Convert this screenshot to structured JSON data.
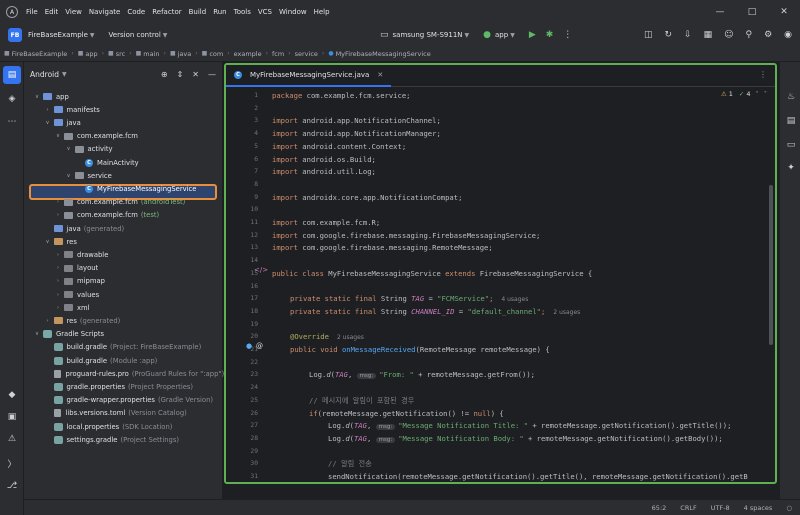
{
  "menu": {
    "logo": "A",
    "items": [
      "File",
      "Edit",
      "View",
      "Navigate",
      "Code",
      "Refactor",
      "Build",
      "Run",
      "Tools",
      "VCS",
      "Window",
      "Help"
    ]
  },
  "toolbar": {
    "project_badge": "FB",
    "project_name": "FireBaseExample",
    "vcs": "Version control",
    "device": "samsung SM-S911N",
    "run_config": "app"
  },
  "breadcrumb": [
    "FireBaseExample",
    "app",
    "src",
    "main",
    "java",
    "com",
    "example",
    "fcm",
    "service",
    "MyFirebaseMessagingService"
  ],
  "project_panel": {
    "title": "Android",
    "tree": [
      {
        "label": "app",
        "note": "",
        "depth": 0,
        "arrow": "down",
        "icon": "folder"
      },
      {
        "label": "manifests",
        "note": "",
        "depth": 1,
        "arrow": "right",
        "icon": "folder"
      },
      {
        "label": "java",
        "note": "",
        "depth": 1,
        "arrow": "down",
        "icon": "folder"
      },
      {
        "label": "com.example.fcm",
        "note": "",
        "depth": 2,
        "arrow": "down",
        "icon": "pkg"
      },
      {
        "label": "activity",
        "note": "",
        "depth": 3,
        "arrow": "down",
        "icon": "pkg"
      },
      {
        "label": "MainActivity",
        "note": "",
        "depth": 4,
        "arrow": "",
        "icon": "class"
      },
      {
        "label": "service",
        "note": "",
        "depth": 3,
        "arrow": "down",
        "icon": "pkg"
      },
      {
        "label": "MyFirebaseMessagingService",
        "note": "",
        "depth": 4,
        "arrow": "",
        "icon": "class"
      },
      {
        "label": "com.example.fcm",
        "note": "(androidTest)",
        "depth": 2,
        "arrow": "right",
        "icon": "pkg"
      },
      {
        "label": "com.example.fcm",
        "note": "(test)",
        "depth": 2,
        "arrow": "right",
        "icon": "pkg"
      },
      {
        "label": "java",
        "note": "(generated)",
        "depth": 1,
        "arrow": "",
        "icon": "folder"
      },
      {
        "label": "res",
        "note": "",
        "depth": 1,
        "arrow": "down",
        "icon": "res"
      },
      {
        "label": "drawable",
        "note": "",
        "depth": 2,
        "arrow": "right",
        "icon": "gray"
      },
      {
        "label": "layout",
        "note": "",
        "depth": 2,
        "arrow": "right",
        "icon": "gray"
      },
      {
        "label": "mipmap",
        "note": "",
        "depth": 2,
        "arrow": "right",
        "icon": "gray"
      },
      {
        "label": "values",
        "note": "",
        "depth": 2,
        "arrow": "right",
        "icon": "gray"
      },
      {
        "label": "xml",
        "note": "",
        "depth": 2,
        "arrow": "right",
        "icon": "gray"
      },
      {
        "label": "res",
        "note": "(generated)",
        "depth": 1,
        "arrow": "right",
        "icon": "res"
      },
      {
        "label": "Gradle Scripts",
        "note": "",
        "depth": 0,
        "arrow": "down",
        "icon": "scripts"
      },
      {
        "label": "build.gradle",
        "note": "(Project: FireBaseExample)",
        "depth": 1,
        "arrow": "",
        "icon": "gradle"
      },
      {
        "label": "build.gradle",
        "note": "(Module :app)",
        "depth": 1,
        "arrow": "",
        "icon": "gradle"
      },
      {
        "label": "proguard-rules.pro",
        "note": "(ProGuard Rules for \":app\")",
        "depth": 1,
        "arrow": "",
        "icon": "file"
      },
      {
        "label": "gradle.properties",
        "note": "(Project Properties)",
        "depth": 1,
        "arrow": "",
        "icon": "gradle"
      },
      {
        "label": "gradle-wrapper.properties",
        "note": "(Gradle Version)",
        "depth": 1,
        "arrow": "",
        "icon": "gradle"
      },
      {
        "label": "libs.versions.toml",
        "note": "(Version Catalog)",
        "depth": 1,
        "arrow": "",
        "icon": "file"
      },
      {
        "label": "local.properties",
        "note": "(SDK Location)",
        "depth": 1,
        "arrow": "",
        "icon": "gradle"
      },
      {
        "label": "settings.gradle",
        "note": "(Project Settings)",
        "depth": 1,
        "arrow": "",
        "icon": "gradle"
      }
    ]
  },
  "editor": {
    "tab": "MyFirebaseMessagingService.java",
    "warnings": "1",
    "ok_count": "4",
    "line_numbers": [
      "1",
      "2",
      "3",
      "4",
      "5",
      "6",
      "7",
      "8",
      "9",
      "10",
      "11",
      "12",
      "13",
      "14",
      "15",
      "16",
      "17",
      "18",
      "19",
      "20",
      "21",
      "22",
      "23",
      "24",
      "25",
      "26",
      "27",
      "28",
      "29",
      "30",
      "31"
    ],
    "code": {
      "l1": {
        "kw": "package ",
        "rest": "com.example.fcm.service;"
      },
      "l3": {
        "kw": "import ",
        "rest": "android.app.NotificationChannel;"
      },
      "l4": {
        "kw": "import ",
        "rest": "android.app.NotificationManager;"
      },
      "l5": {
        "kw": "import ",
        "rest": "android.content.Context;"
      },
      "l6": {
        "kw": "import ",
        "rest": "android.os.Build;"
      },
      "l7": {
        "kw": "import ",
        "rest": "android.util.Log;"
      },
      "l9": {
        "kw": "import ",
        "rest": "androidx.core.app.NotificationCompat;"
      },
      "l11": {
        "kw": "import ",
        "rest": "com.example.fcm.R;"
      },
      "l12": {
        "kw": "import ",
        "rest": "com.google.firebase.messaging.FirebaseMessagingService;"
      },
      "l13": {
        "kw": "import ",
        "rest": "com.google.firebase.messaging.RemoteMessage;"
      },
      "l15": {
        "kw1": "public class ",
        "name": "MyFirebaseMessagingService ",
        "kw2": "extends ",
        "rest": "FirebaseMessagingService {"
      },
      "l17": {
        "kw": "private static final ",
        "type": "String ",
        "const": "TAG",
        "eq": " = ",
        "str": "\"FCMService\"",
        "end": ";",
        "hint": "4 usages"
      },
      "l18": {
        "kw": "private static final ",
        "type": "String ",
        "const": "CHANNEL_ID",
        "eq": " = ",
        "str": "\"default_channel\"",
        "end": ";",
        "hint": "2 usages"
      },
      "l20": {
        "ann": "@Override",
        "hint": "2 usages"
      },
      "l21": {
        "kw": "public void ",
        "fn": "onMessageReceived",
        "rest": "(RemoteMessage remoteMessage) {"
      },
      "l23": {
        "pre": "Log.",
        "fn": "d",
        "open": "(",
        "const": "TAG",
        "comma": ", ",
        "pill": "msg:",
        "str": "\"From: \"",
        "rest": " + remoteMessage.getFrom());"
      },
      "l25": {
        "cmt": "// 메시지에 알림이 포함된 경우"
      },
      "l26": {
        "kw": "if",
        "rest": "(remoteMessage.getNotification() != ",
        "kw2": "null",
        "end": ") {"
      },
      "l27": {
        "pre": "Log.",
        "fn": "d",
        "open": "(",
        "const": "TAG",
        "comma": ", ",
        "pill": "msg:",
        "str": "\"Message Notification Title: \"",
        "rest": " + remoteMessage.getNotification().getTitle());"
      },
      "l28": {
        "pre": "Log.",
        "fn": "d",
        "open": "(",
        "const": "TAG",
        "comma": ", ",
        "pill": "msg:",
        "str": "\"Message Notification Body: \"",
        "rest": " + remoteMessage.getNotification().getBody());"
      },
      "l30": {
        "cmt": "// 알림 전송"
      },
      "l31": {
        "rest": "sendNotification(remoteMessage.getNotification().getTitle(), remoteMessage.getNotification().getB"
      }
    }
  },
  "status": {
    "position": "65:2",
    "line_sep": "CRLF",
    "encoding": "UTF-8",
    "indent": "4 spaces"
  },
  "colors": {
    "accent": "#3574f0",
    "selection_highlight": "#e88e3d",
    "editor_highlight": "#5fb050"
  }
}
